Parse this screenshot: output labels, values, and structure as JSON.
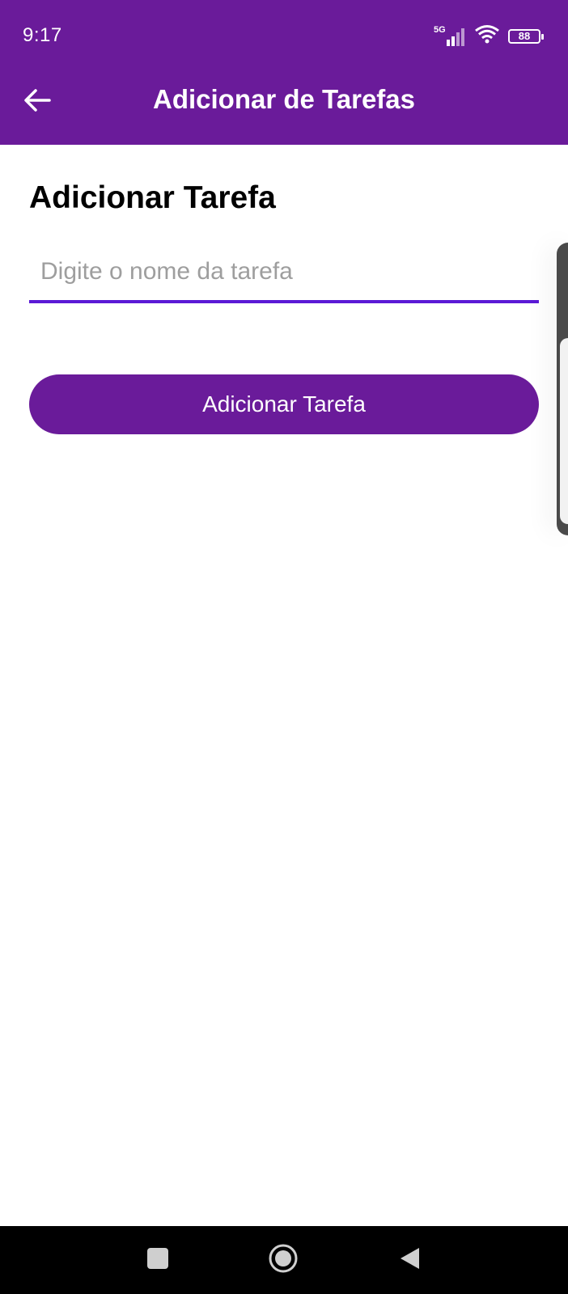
{
  "status_bar": {
    "time": "9:17",
    "network_label": "5G",
    "battery": "88",
    "icons": [
      "signal-icon",
      "wifi-icon",
      "battery-icon"
    ]
  },
  "toolbar": {
    "title": "Adicionar de Tarefas",
    "back_icon": "arrow-left-icon"
  },
  "content": {
    "heading": "Adicionar Tarefa",
    "task_input": {
      "value": "",
      "placeholder": "Digite o nome da tarefa"
    },
    "add_button_label": "Adicionar Tarefa"
  },
  "nav_bar": {
    "buttons": [
      "recent-apps-icon",
      "home-icon",
      "back-triangle-icon"
    ]
  },
  "colors": {
    "primary": "#6a1b9a",
    "input_underline": "#5b1ad6",
    "placeholder": "#9e9e9e",
    "nav_background": "#000000"
  }
}
